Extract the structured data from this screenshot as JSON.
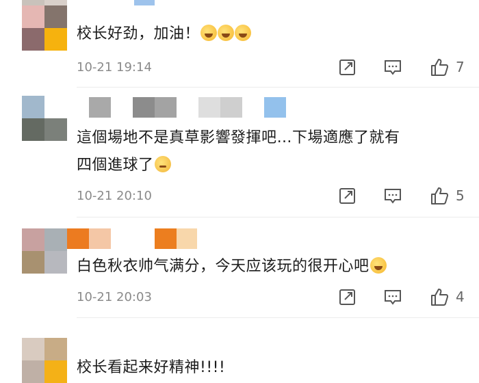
{
  "comments": [
    {
      "text": "校长好劲，加油！",
      "emoji_names": [
        "crying-face-emoji",
        "crying-face-emoji",
        "crying-face-emoji"
      ],
      "time": "10-21 19:14",
      "likes": "7"
    },
    {
      "text_line1": "這個場地不是真草影響發揮吧…下場適應了就有",
      "text_line2": "四個進球了",
      "emoji_names": [
        "thinking-face-emoji"
      ],
      "time": "10-21 20:10",
      "likes": "5"
    },
    {
      "text": "白色秋衣帅气满分，今天应该玩的很开心吧",
      "emoji_names": [
        "laughing-face-emoji"
      ],
      "time": "10-21 20:03",
      "likes": "4"
    },
    {
      "text": "校长看起来好精神!!!!"
    }
  ],
  "icons": {
    "share": "share-icon",
    "comment": "comment-icon",
    "like": "thumbs-up-icon"
  },
  "colors": {
    "meta_gray": "#8a8a8a",
    "icon_gray": "#555555"
  }
}
